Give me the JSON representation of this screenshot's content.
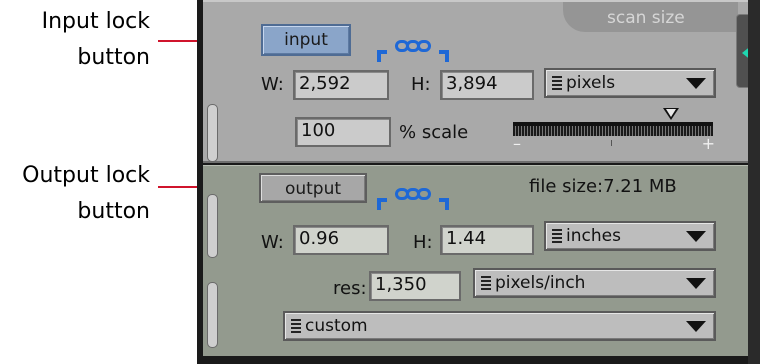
{
  "callouts": {
    "input_lock_line1": "Input lock",
    "input_lock_line2": "button",
    "output_lock_line1": "Output lock",
    "output_lock_line2": "button"
  },
  "scan_size": {
    "tab_label": "scan size"
  },
  "input": {
    "button_label": "input",
    "width_label": "W:",
    "width_value": "2,592",
    "height_label": "H:",
    "height_value": "3,894",
    "unit": "pixels",
    "scale_value": "100",
    "scale_label": "% scale",
    "slider_minus": "–",
    "slider_plus": "+",
    "slider_level": 0.79
  },
  "output": {
    "button_label": "output",
    "file_size": "file size:7.21 MB",
    "width_label": "W:",
    "width_value": "0.96",
    "height_label": "H:",
    "height_value": "1.44",
    "unit": "inches",
    "res_label": "res:",
    "res_value": "1,350",
    "res_unit": "pixels/inch",
    "preset": "custom"
  },
  "colors": {
    "leader": "#d0142c",
    "lock_chain": "#1e68d6",
    "rail_arrow": "#1fd6b0"
  },
  "icons": {
    "chain": "lock-chain-icon",
    "rail": "panel-collapse-arrow-icon"
  }
}
